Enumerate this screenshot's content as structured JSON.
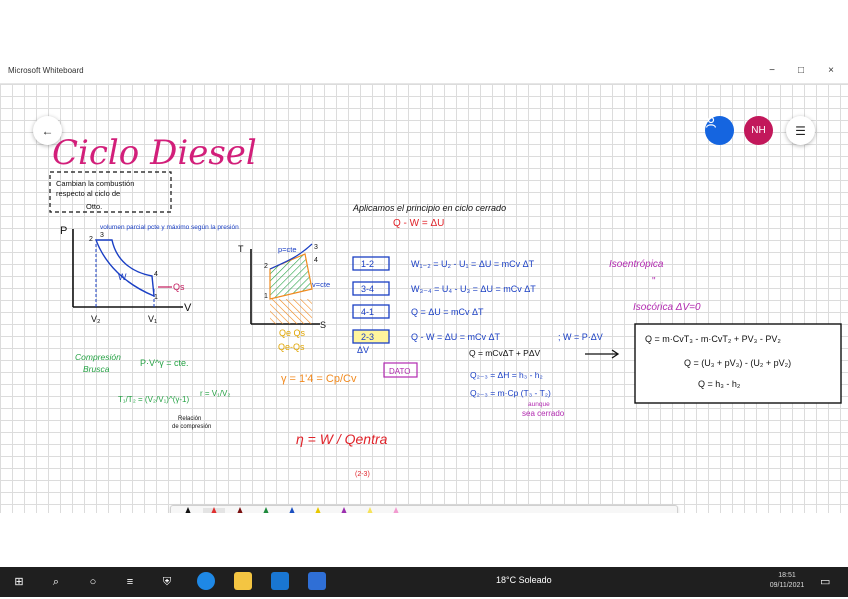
{
  "window": {
    "title": "Microsoft Whiteboard",
    "controls": {
      "minimize": "−",
      "maximize": "□",
      "close": "×"
    }
  },
  "header_buttons": {
    "back_icon": "arrow-left-icon",
    "user_icon": "person-icon",
    "avatar_initials": "NH",
    "menu_icon": "hamburger-icon"
  },
  "board": {
    "title": "Ciclo Diesel",
    "note": [
      "Cambian la combustión",
      "respecto al ciclo de",
      "Otto."
    ],
    "pv_diagram": {
      "axis_p": "P",
      "axis_v": "V",
      "annotation": "volumen parcial pcte y máximo según la presión",
      "points": [
        "2",
        "3",
        "4",
        "1"
      ],
      "labels": {
        "w": "W",
        "qs": "Qs",
        "v2": "V₂",
        "v1": "V₁"
      }
    },
    "ts_diagram": {
      "axis_t": "T",
      "axis_s": "S",
      "curve_p": "p=cte",
      "curve_v": "v=cte",
      "points": [
        "2",
        "3",
        "4",
        "1"
      ],
      "labels": {
        "qe_qs": "Qe  Qs",
        "qe_minus_qs": "Qe-Qs"
      }
    },
    "principle_title": "Aplicamos el principio en ciclo cerrado",
    "principle_eq": "Q - W = ΔU",
    "steps": [
      {
        "tag": "1-2",
        "eq": "W₁₋₂ = U₂ - U₁ = ΔU = mCv ΔT",
        "note": "Isoentrópica"
      },
      {
        "tag": "3-4",
        "eq": "W₃₋₄ = U₄ - U₃ = ΔU = mCv ΔT",
        "note": "\""
      },
      {
        "tag": "4-1",
        "eq": "Q = ΔU = mCv ΔT",
        "note": "Isocórica ΔV=0"
      },
      {
        "tag": "2-3",
        "eq": "Q - W = ΔU = mCv ΔT",
        "note": "; W = P·ΔV"
      }
    ],
    "delta_v": "ΔV",
    "q_expansion": "Q = mCvΔT + PΔV",
    "box_lines": [
      "Q = m·CvT₃ - m·CvT₂ + PV₃ - PV₂",
      "Q = (U₃ + pV₃) - (U₂ + pV₂)",
      "Q = h₃ - h₂"
    ],
    "dato": "DATO",
    "enthalpy_lines": [
      "Q₂₋₃ = ΔH = h₃ - h₂",
      "Q₂₋₃ = m·Cp (T₃ - T₂)"
    ],
    "enthalpy_note": [
      "aunque",
      "sea cerrado"
    ],
    "compression_title": [
      "Compresión",
      "Brusca"
    ],
    "compression_eq": "P·V^γ = cte.",
    "ratio_eq": "T₁/T₂ = (V₂/V₁)^(γ-1)",
    "r_eq": "r = V₁/V₂",
    "relation_label": [
      "Relación",
      "de compresión"
    ],
    "gamma_eq": "γ = 1'4 = Cp/Cv",
    "efficiency_eq": "η = W / Qentra",
    "efficiency_sub": "(2-3)"
  },
  "pen_tray": {
    "pens": [
      {
        "name": "pen-black",
        "color": "#111111"
      },
      {
        "name": "pen-red",
        "color": "#e03030"
      },
      {
        "name": "pen-darkred",
        "color": "#7a1010"
      },
      {
        "name": "pen-green",
        "color": "#1e8a3c"
      },
      {
        "name": "pen-blue",
        "color": "#1a4fc0"
      },
      {
        "name": "pen-yellow",
        "color": "#e8c800"
      },
      {
        "name": "pen-purple",
        "color": "#9b2fae"
      },
      {
        "name": "highlighter-yellow",
        "color": "#f6e35a"
      },
      {
        "name": "highlighter-pink",
        "color": "#f29bd0"
      }
    ],
    "tools": [
      "ruler-icon",
      "lasso-icon",
      "text-icon",
      "note-icon",
      "image-icon",
      "add-icon",
      "undo-icon",
      "redo-icon"
    ]
  },
  "taskbar": {
    "weather": "18°C Soleado",
    "clock": [
      "18:51",
      "09/11/2021"
    ],
    "apps": [
      "start-icon",
      "search-icon",
      "taskview-icon",
      "widgets-icon",
      "security-icon",
      "edge-icon",
      "explorer-icon",
      "mail-icon",
      "whiteboard-icon"
    ]
  },
  "colors": {
    "title_pink": "#d21f7a",
    "ink_blue": "#1a3fc4",
    "ink_green": "#25a244",
    "ink_red": "#e0232a",
    "ink_orange": "#f18a1f",
    "ink_purple": "#b22ab0",
    "ink_black": "#111111"
  }
}
